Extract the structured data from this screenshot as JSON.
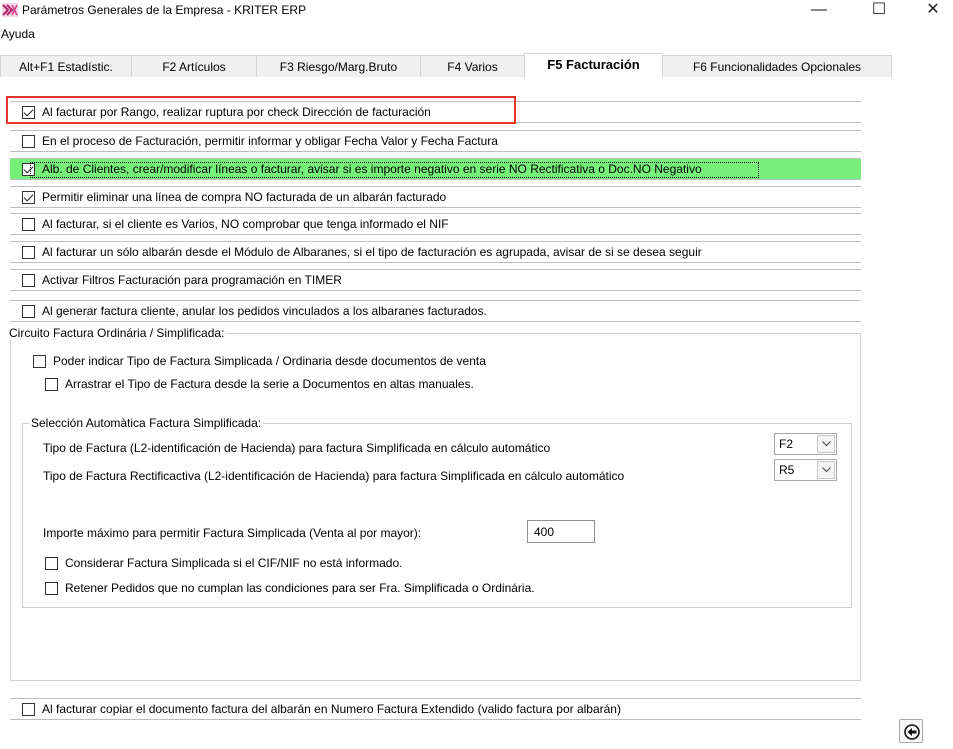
{
  "window": {
    "title": "Parámetros Generales de la Empresa - KRITER ERP",
    "minimize_glyph": "—",
    "maximize_glyph": "☐",
    "close_glyph": "✕"
  },
  "menu": {
    "ayuda": "Ayuda"
  },
  "tabs": [
    {
      "label": "Alt+F1 Estadístic."
    },
    {
      "label": "F2 Artículos"
    },
    {
      "label": "F3 Riesgo/Marg.Bruto"
    },
    {
      "label": "F4 Varios"
    },
    {
      "label": "F5 Facturación",
      "active": true
    },
    {
      "label": "F6 Funcionalidades Opcionales"
    }
  ],
  "options": [
    {
      "label": "Al facturar por Rango, realizar ruptura por check Dirección de facturación",
      "checked": true
    },
    {
      "label": "En el proceso de Facturación, permitir informar y obligar Fecha Valor y Fecha Factura",
      "checked": false
    },
    {
      "label": "Alb. de Clientes, crear/modificar líneas o facturar, avisar si es importe negativo en serie NO Rectificativa o Doc.NO Negativo",
      "checked": true
    },
    {
      "label": "Permitir eliminar una línea de compra NO facturada de un albarán facturado",
      "checked": true
    },
    {
      "label": "Al facturar, si el cliente es Varios, NO comprobar que tenga informado el NIF",
      "checked": false
    },
    {
      "label": "Al facturar un sólo albarán desde el Módulo de Albaranes, si el tipo de facturación es agrupada, avisar de si se desea seguir",
      "checked": false
    },
    {
      "label": "Activar Filtros Facturación para programación en TIMER",
      "checked": false
    },
    {
      "label": "Al generar factura cliente, anular los pedidos vinculados a los albaranes facturados.",
      "checked": false
    }
  ],
  "circuito": {
    "legend": "Circuito Factura Ordinária / Simplificada:",
    "poder_indicar": "Poder indicar Tipo de Factura Simplicada / Ordinaria desde documentos de venta",
    "arrastrar": "Arrastrar el Tipo de Factura desde la serie a Documentos en altas manuales.",
    "seleccion": {
      "legend": "Selección Automàtica Factura Simplificada:",
      "tipo_factura_label": "Tipo de Factura (L2-identificación de Hacienda) para factura Simplificada en cálculo automático",
      "tipo_factura_value": "F2",
      "tipo_rect_label": "Tipo de Factura Rectificactiva (L2-identificación de Hacienda) para factura Simplificada en cálculo automático",
      "tipo_rect_value": "R5",
      "importe_label": "Importe máximo para permitir Factura Simplicada (Venta al por mayor):",
      "importe_value": "400",
      "considerar": "Considerar Factura Simplicada si el CIF/NIF no está informado.",
      "retener": "Retener Pedidos que no cumplan las condiciones para ser Fra. Simplificada o Ordinária."
    }
  },
  "bottom_option": {
    "label": "Al facturar copiar el documento factura del albarán en Numero Factura Extendido (valido factura por albarán)",
    "checked": false
  },
  "colors": {
    "highlight_row": "#77f07a",
    "annotation_box": "#e5362a"
  },
  "icons": {
    "back": "arrow-left-circle-icon",
    "app": "kriter-app-icon"
  }
}
